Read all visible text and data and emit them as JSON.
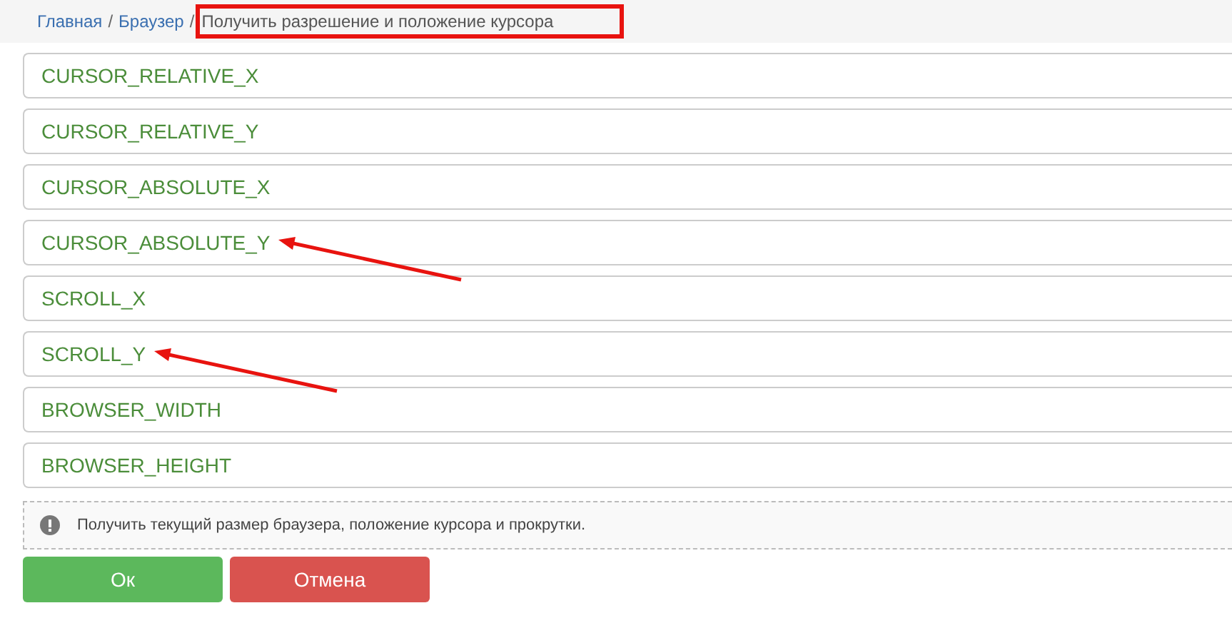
{
  "breadcrumb_separator": "/",
  "breadcrumb": [
    {
      "label": "Главная",
      "current": false,
      "highlighted": false
    },
    {
      "label": "Браузер",
      "current": false,
      "highlighted": false
    },
    {
      "label": "Получить разрешение и положение курсора",
      "current": true,
      "highlighted": true
    }
  ],
  "options": [
    {
      "label": "CURSOR_RELATIVE_X",
      "marked": false
    },
    {
      "label": "CURSOR_RELATIVE_Y",
      "marked": false
    },
    {
      "label": "CURSOR_ABSOLUTE_X",
      "marked": false
    },
    {
      "label": "CURSOR_ABSOLUTE_Y",
      "marked": true
    },
    {
      "label": "SCROLL_X",
      "marked": false
    },
    {
      "label": "SCROLL_Y",
      "marked": true
    },
    {
      "label": "BROWSER_WIDTH",
      "marked": false
    },
    {
      "label": "BROWSER_HEIGHT",
      "marked": false
    }
  ],
  "info": {
    "text": "Получить текущий размер браузера, положение курсора и прокрутки."
  },
  "buttons": [
    {
      "label": "Ок",
      "kind": "ok"
    },
    {
      "label": "Отмена",
      "kind": "cancel"
    }
  ]
}
